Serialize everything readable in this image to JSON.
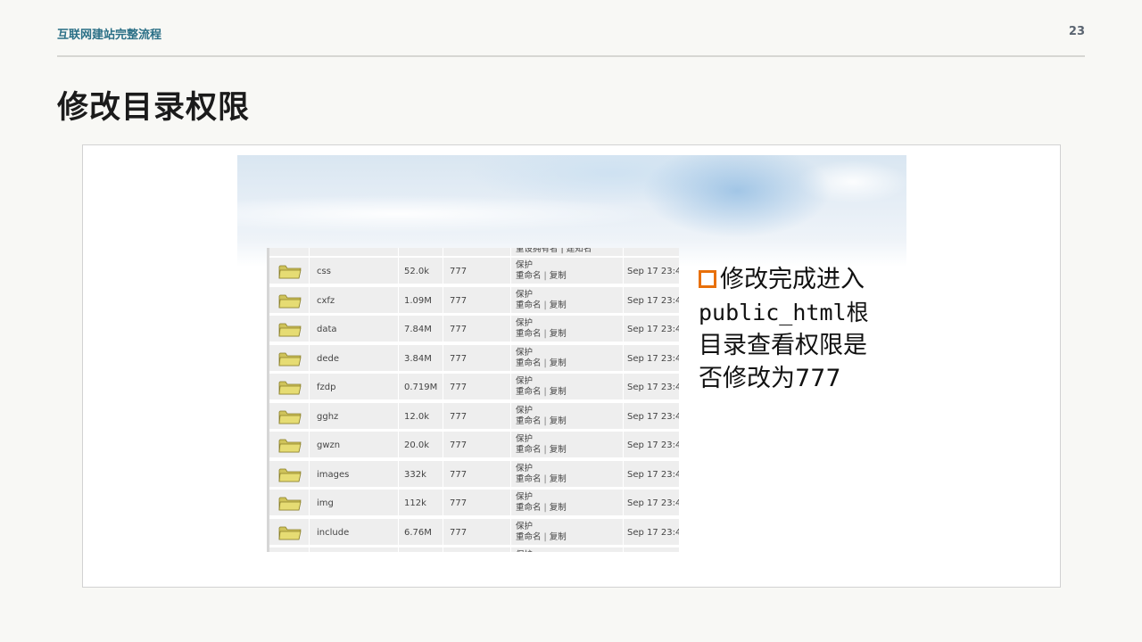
{
  "header": {
    "title": "互联网建站完整流程",
    "page_number": "23"
  },
  "slide": {
    "title": "修改目录权限"
  },
  "file_table": {
    "partial_top_row_actions": "重设拥有者 | 建知名",
    "rows": [
      {
        "name": "css",
        "size": "52.0k",
        "perm": "777",
        "action_protect": "保护",
        "action_rename": "重命名",
        "action_copy": "复制",
        "date": "Sep 17 23:4"
      },
      {
        "name": "cxfz",
        "size": "1.09M",
        "perm": "777",
        "action_protect": "保护",
        "action_rename": "重命名",
        "action_copy": "复制",
        "date": "Sep 17 23:4"
      },
      {
        "name": "data",
        "size": "7.84M",
        "perm": "777",
        "action_protect": "保护",
        "action_rename": "重命名",
        "action_copy": "复制",
        "date": "Sep 17 23:4"
      },
      {
        "name": "dede",
        "size": "3.84M",
        "perm": "777",
        "action_protect": "保护",
        "action_rename": "重命名",
        "action_copy": "复制",
        "date": "Sep 17 23:4"
      },
      {
        "name": "fzdp",
        "size": "0.719M",
        "perm": "777",
        "action_protect": "保护",
        "action_rename": "重命名",
        "action_copy": "复制",
        "date": "Sep 17 23:4"
      },
      {
        "name": "gghz",
        "size": "12.0k",
        "perm": "777",
        "action_protect": "保护",
        "action_rename": "重命名",
        "action_copy": "复制",
        "date": "Sep 17 23:4"
      },
      {
        "name": "gwzn",
        "size": "20.0k",
        "perm": "777",
        "action_protect": "保护",
        "action_rename": "重命名",
        "action_copy": "复制",
        "date": "Sep 17 23:4"
      },
      {
        "name": "images",
        "size": "332k",
        "perm": "777",
        "action_protect": "保护",
        "action_rename": "重命名",
        "action_copy": "复制",
        "date": "Sep 17 23:4"
      },
      {
        "name": "img",
        "size": "112k",
        "perm": "777",
        "action_protect": "保护",
        "action_rename": "重命名",
        "action_copy": "复制",
        "date": "Sep 17 23:4"
      },
      {
        "name": "include",
        "size": "6.76M",
        "perm": "777",
        "action_protect": "保护",
        "action_rename": "重命名",
        "action_copy": "复制",
        "date": "Sep 17 23:4"
      }
    ],
    "partial_bottom_row_action": "保护",
    "icon": "folder-icon"
  },
  "note": {
    "line1": "修改完成进入",
    "line2": "public_html根",
    "line3": "目录查看权限是",
    "line4": "否修改为777",
    "bullet_icon": "square-bullet-icon"
  },
  "colors": {
    "accent_title": "#2a6f86",
    "bullet": "#e8700a",
    "folder": "#e6dc73"
  }
}
